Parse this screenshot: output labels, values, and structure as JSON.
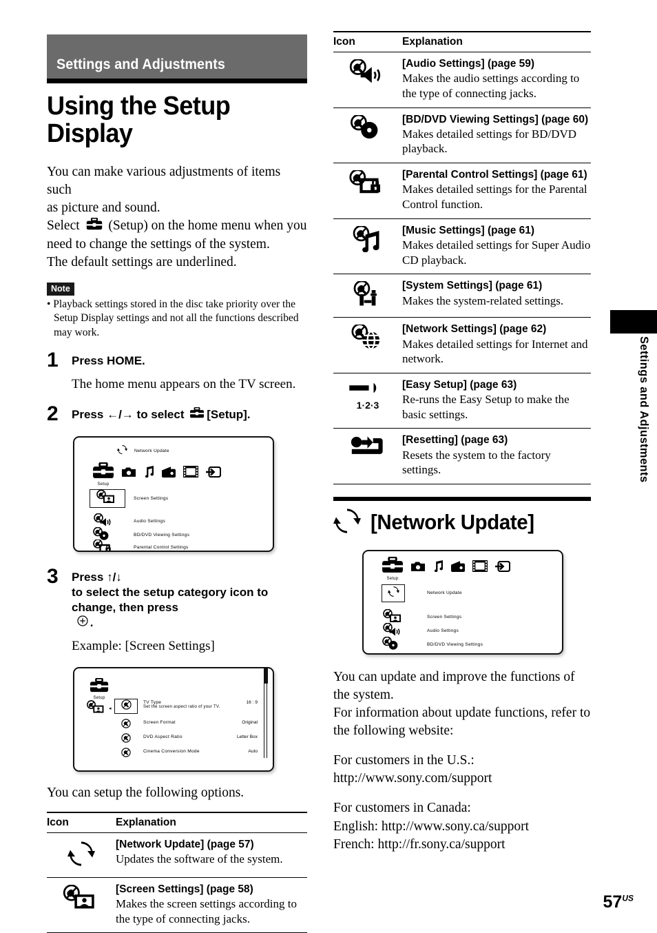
{
  "chapter": {
    "band_title": "Settings and Adjustments",
    "side_tab": "Settings and Adjustments"
  },
  "page_title": "Using the Setup Display",
  "intro": {
    "line1": "You can make various adjustments of items such",
    "line2": "as picture and sound.",
    "line3_a": "Select",
    "line3_b": "(Setup) on the home menu when you",
    "line4": "need to change the settings of the system.",
    "line5": "The default settings are underlined."
  },
  "note": {
    "badge": "Note",
    "text": "• Playback settings stored in the disc take priority over the Setup Display settings and not all the functions described may work."
  },
  "steps": [
    {
      "num": "1",
      "head": "Press HOME.",
      "sub": "The home menu appears on the TV screen."
    },
    {
      "num": "2",
      "head_a": "Press",
      "arrows": "←/→",
      "head_b": "to select",
      "head_c": "[Setup]."
    },
    {
      "num": "3",
      "head_a": "Press",
      "arrows": "↑/↓",
      "head_b": "to select the setup category icon to change, then press",
      "head_c": ".",
      "sub": "Example: [Screen Settings]"
    }
  ],
  "tv_home": {
    "top_item": "Network Update",
    "setup_label": "Setup",
    "category_icons": [
      "toolbox-setup-icon",
      "camera-icon",
      "music-note-icon",
      "radio-icon",
      "film-strip-icon",
      "input-arrow-icon"
    ],
    "items": [
      {
        "label": "Screen Settings",
        "icon": "screen-settings-icon",
        "selected": true
      },
      {
        "label": "Audio Settings",
        "icon": "audio-settings-icon",
        "selected": false
      },
      {
        "label": "BD/DVD Viewing Settings",
        "icon": "bd-dvd-viewing-settings-icon",
        "selected": false
      },
      {
        "label": "Parental Control Settings",
        "icon": "parental-control-settings-icon",
        "selected": false
      }
    ]
  },
  "tv_screen_settings": {
    "setup_label": "Setup",
    "category_icon": "screen-settings-icon",
    "rows": [
      {
        "label": "TV Type",
        "desc": "Set the screen aspect ratio of your TV.",
        "value": "16 : 9",
        "selected": true
      },
      {
        "label": "Screen Format",
        "desc": "",
        "value": "Original",
        "selected": false
      },
      {
        "label": "DVD Aspect Ratio",
        "desc": "",
        "value": "Letter Box",
        "selected": false
      },
      {
        "label": "Cinema Conversion Mode",
        "desc": "",
        "value": "Auto",
        "selected": false
      }
    ]
  },
  "tv_network_update": {
    "setup_label": "Setup",
    "category_icons": [
      "toolbox-setup-icon",
      "camera-icon",
      "music-note-icon",
      "radio-icon",
      "film-strip-icon",
      "input-arrow-icon"
    ],
    "items": [
      {
        "label": "Network Update",
        "icon": "network-update-icon",
        "selected": true
      },
      {
        "label": "Screen Settings",
        "icon": "screen-settings-icon",
        "selected": false
      },
      {
        "label": "Audio Settings",
        "icon": "audio-settings-icon",
        "selected": false
      },
      {
        "label": "BD/DVD Viewing Settings",
        "icon": "bd-dvd-viewing-settings-icon",
        "selected": false
      }
    ]
  },
  "options_lead": "You can setup the following options.",
  "table_left": {
    "headers": {
      "icon": "Icon",
      "explanation": "Explanation"
    },
    "rows": [
      {
        "icon": "network-update-icon",
        "title": "[Network Update] (page 57)",
        "desc": "Updates the software of the system."
      },
      {
        "icon": "screen-settings-icon",
        "title": "[Screen Settings] (page 58)",
        "desc": "Makes the screen settings according to the type of connecting jacks."
      }
    ]
  },
  "table_right": {
    "headers": {
      "icon": "Icon",
      "explanation": "Explanation"
    },
    "rows": [
      {
        "icon": "audio-settings-icon",
        "title": "[Audio Settings] (page 59)",
        "desc": "Makes the audio settings according to the type of connecting jacks."
      },
      {
        "icon": "bd-dvd-viewing-settings-icon",
        "title": "[BD/DVD Viewing Settings] (page 60)",
        "desc": "Makes detailed settings for BD/DVD playback."
      },
      {
        "icon": "parental-control-settings-icon",
        "title": "[Parental Control Settings] (page 61)",
        "desc": "Makes detailed settings for the Parental Control function."
      },
      {
        "icon": "music-settings-icon",
        "title": "[Music Settings] (page 61)",
        "desc": "Makes detailed settings for Super Audio CD playback."
      },
      {
        "icon": "system-settings-icon",
        "title": "[System Settings] (page 61)",
        "desc": "Makes the system-related settings."
      },
      {
        "icon": "network-settings-icon",
        "title": "[Network Settings] (page 62)",
        "desc": "Makes detailed settings for Internet and network."
      },
      {
        "icon": "easy-setup-icon",
        "icon_caption": "1·2·3",
        "title": "[Easy Setup] (page 63)",
        "desc": "Re-runs the Easy Setup to make the basic settings."
      },
      {
        "icon": "resetting-icon",
        "title": "[Resetting] (page 63)",
        "desc": "Resets the system to the factory settings."
      }
    ]
  },
  "section_network_update": {
    "heading": "[Network Update]",
    "icon": "network-update-icon",
    "para1": "You can update and improve the functions of the system.",
    "para2": "For information about update functions, refer to the following website:",
    "us_label": "For customers in the U.S.:",
    "us_url": "http://www.sony.com/support",
    "ca_label": "For customers in Canada:",
    "ca_en": "English: http://www.sony.ca/support",
    "ca_fr": "French: http://fr.sony.ca/support"
  },
  "folio": {
    "number": "57",
    "region": "US"
  }
}
